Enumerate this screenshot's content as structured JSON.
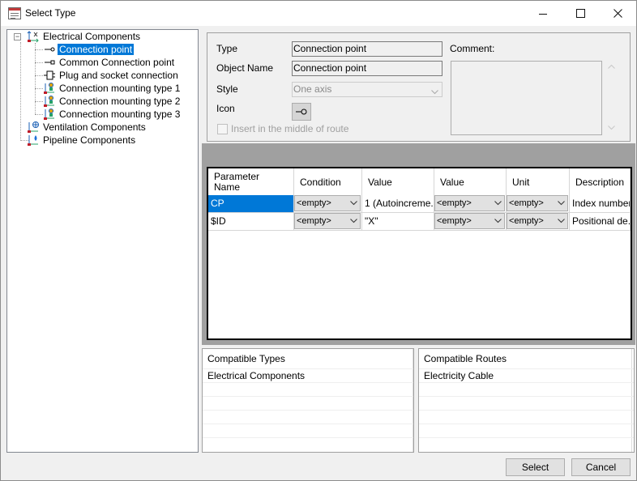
{
  "window": {
    "title": "Select Type",
    "minimize_glyph": "minimize-icon",
    "maximize_glyph": "maximize-icon",
    "close_glyph": "close-icon"
  },
  "tree": {
    "root": {
      "label": "Electrical Components",
      "expander": "−"
    },
    "children": [
      {
        "label": "Connection point",
        "selected": true
      },
      {
        "label": "Common Connection point"
      },
      {
        "label": "Plug and socket connection"
      },
      {
        "label": "Connection mounting type 1"
      },
      {
        "label": "Connection mounting type 2"
      },
      {
        "label": "Connection mounting type 3"
      }
    ],
    "siblings": [
      {
        "label": "Ventilation Components",
        "expander": "+"
      },
      {
        "label": "Pipeline Components"
      }
    ]
  },
  "properties": {
    "type_label": "Type",
    "type_value": "Connection point",
    "object_name_label": "Object Name",
    "object_name_value": "Connection point",
    "style_label": "Style",
    "style_value": "One axis",
    "icon_label": "Icon",
    "insert_label": "Insert in the middle of route",
    "comment_label": "Comment:"
  },
  "grid": {
    "headers": [
      "Parameter\nName",
      "Condition",
      "Value",
      "Value",
      "Unit",
      "Description"
    ],
    "rows": [
      {
        "name": "CP",
        "condition": "<empty>",
        "value1": "1 (Autoincreme...",
        "value2": "<empty>",
        "unit": "<empty>",
        "description": "Index number"
      },
      {
        "name": "$ID",
        "condition": "<empty>",
        "value1": "\"X\"",
        "value2": "<empty>",
        "unit": "<empty>",
        "description": "Positional de..."
      }
    ]
  },
  "compatible_types": {
    "header": "Compatible Types",
    "items": [
      "Electrical Components"
    ]
  },
  "compatible_routes": {
    "header": "Compatible Routes",
    "items": [
      "Electricity Cable"
    ]
  },
  "buttons": {
    "select": "Select",
    "cancel": "Cancel"
  },
  "colors": {
    "selection": "#0078d7",
    "gray_band": "#a0a0a0",
    "window_bg": "#f0f0f0"
  }
}
